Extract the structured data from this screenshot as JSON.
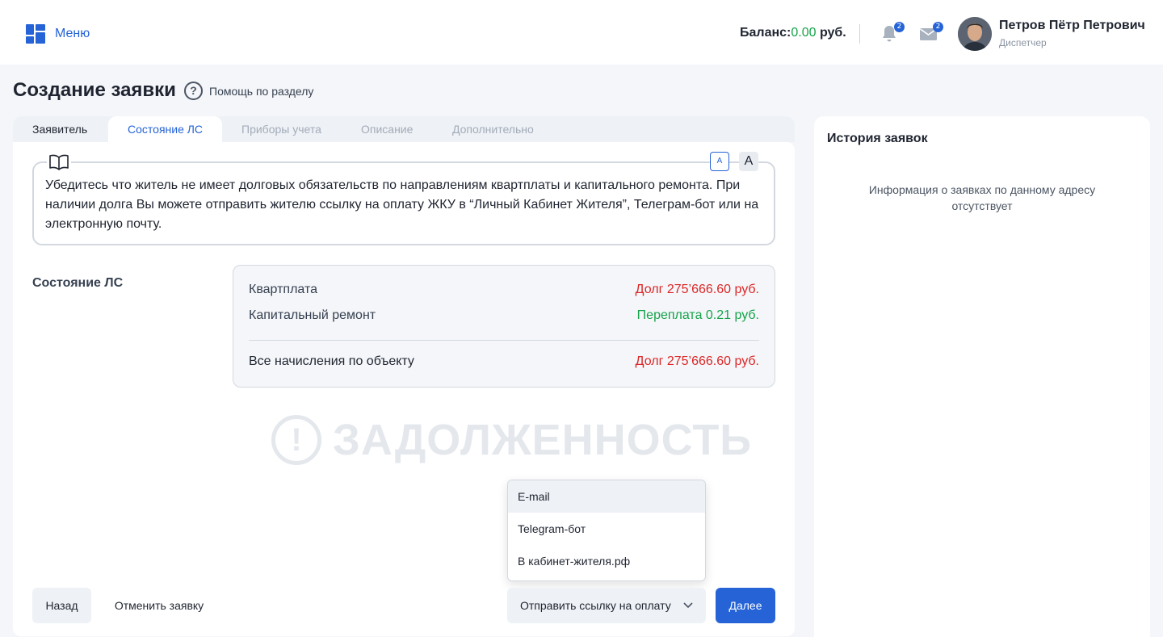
{
  "header": {
    "menu_label": "Меню",
    "balance_label": "Баланс:",
    "balance_value": "0.00",
    "balance_currency": "руб.",
    "notifications_count": "2",
    "messages_count": "2",
    "user_name": "Петров Пётр Петрович",
    "user_role": "Диспетчер",
    "icons": {
      "menu": "grid-icon",
      "notifications": "bell-icon",
      "messages": "envelope-icon",
      "avatar": "user-avatar"
    }
  },
  "page": {
    "title": "Создание заявки",
    "help_label": "Помощь по разделу",
    "help_icon": "?"
  },
  "tabs": [
    {
      "label": "Заявитель",
      "state": "done"
    },
    {
      "label": "Состояние ЛС",
      "state": "active"
    },
    {
      "label": "Приборы учета",
      "state": "disabled"
    },
    {
      "label": "Описание",
      "state": "disabled"
    },
    {
      "label": "Дополнительно",
      "state": "disabled"
    }
  ],
  "notice": {
    "text": "Убедитесь что житель не имеет долговых обязательств по направлениям квартплаты и капитального ремонта. При наличии долга Вы можете отправить жителю ссылку на оплату ЖКУ в “Личный Кабинет Жителя”, Телеграм-бот или на электронную почту.",
    "font_small_label": "A",
    "font_large_label": "A"
  },
  "account": {
    "label": "Состояние ЛС",
    "rows": [
      {
        "name": "Квартплата",
        "value": "Долг 275’666.60 руб.",
        "status": "debt"
      },
      {
        "name": "Капитальный ремонт",
        "value": "Переплата 0.21 руб.",
        "status": "overpayment"
      }
    ],
    "total": {
      "name": "Все начисления по объекту",
      "value": "Долг 275’666.60 руб.",
      "status": "debt"
    },
    "status_colors": {
      "debt": "#dc2626",
      "overpayment": "#16a34a"
    }
  },
  "watermark": {
    "icon": "!",
    "text": "ЗАДОЛЖЕННОСТЬ"
  },
  "send_menu": {
    "items": [
      "E-mail",
      "Telegram-бот",
      "В кабинет-жителя.рф"
    ],
    "hovered_index": 0
  },
  "actions": {
    "back_label": "Назад",
    "cancel_label": "Отменить заявку",
    "send_label": "Отправить ссылку на оплату",
    "next_label": "Далее"
  },
  "history": {
    "title": "История заявок",
    "empty_text": "Информация о заявках по данному адресу отсутствует"
  },
  "colors": {
    "accent": "#2563d6",
    "success": "#16a34a",
    "danger": "#dc2626",
    "background": "#f4f6f9"
  }
}
